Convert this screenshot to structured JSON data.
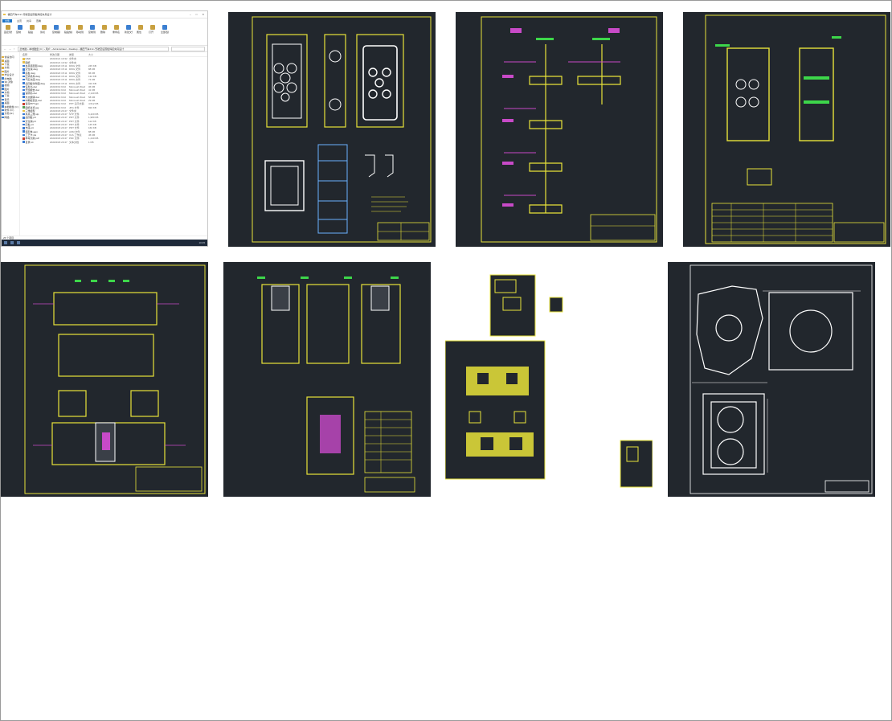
{
  "explorer": {
    "title": "福田汽车4×2~驾驶室后围板焊接夹具设计",
    "menu": [
      "文件",
      "主页",
      "共享",
      "查看"
    ],
    "active_menu": "文件",
    "ribbon": [
      "固定到快速访问",
      "复制",
      "粘贴",
      "剪切",
      "复制路径",
      "粘贴快捷方式",
      "移动到",
      "复制到",
      "删除",
      "重命名",
      "新建文件夹",
      "属性",
      "打开",
      "全部选择"
    ],
    "address": "此电脑 › 本地磁盘 (C:) › 用户 › Administrator › Desktop › 福田汽车4×2~驾驶室后围板焊接夹具设计",
    "nav": [
      "快速访问",
      "桌面",
      "下载",
      "文档",
      "图片",
      "毕业设计",
      "此电脑",
      "3D 对象",
      "视频",
      "图片",
      "文档",
      "下载",
      "音乐",
      "桌面",
      "本地磁盘 (C:)",
      "软件 (D:)",
      "文档 (E:)",
      "网络"
    ],
    "columns": [
      "名称",
      "修改日期",
      "类型",
      "大小"
    ],
    "files": [
      {
        "name": "CAD",
        "date": "2020/4/21 10:32",
        "type": "文件夹",
        "size": "",
        "kind": "folder"
      },
      {
        "name": "图纸",
        "date": "2020/4/21 10:32",
        "type": "文件夹",
        "size": "",
        "kind": "folder"
      },
      {
        "name": "夹具装配图.dwg",
        "date": "2020/4/20 15:11",
        "type": "DWG 文件",
        "size": "245 KB",
        "kind": "file"
      },
      {
        "name": "定位块.dwg",
        "date": "2020/4/20 15:11",
        "type": "DWG 文件",
        "size": "88 KB",
        "kind": "file"
      },
      {
        "name": "底板.dwg",
        "date": "2020/4/20 15:11",
        "type": "DWG 文件",
        "size": "96 KB",
        "kind": "file"
      },
      {
        "name": "压紧机构.dwg",
        "date": "2020/4/20 15:11",
        "type": "DWG 文件",
        "size": "132 KB",
        "kind": "file"
      },
      {
        "name": "气缸支座.dwg",
        "date": "2020/4/20 15:11",
        "type": "DWG 文件",
        "size": "74 KB",
        "kind": "file"
      },
      {
        "name": "后围板零件图.dwg",
        "date": "2020/4/20 15:11",
        "type": "DWG 文件",
        "size": "310 KB",
        "kind": "file"
      },
      {
        "name": "任务书.doc",
        "date": "2020/4/19 9:02",
        "type": "Microsoft Word",
        "size": "36 KB",
        "kind": "file"
      },
      {
        "name": "开题报告.doc",
        "date": "2020/4/19 9:02",
        "type": "Microsoft Word",
        "size": "41 KB",
        "kind": "file"
      },
      {
        "name": "说明书.doc",
        "date": "2020/4/19 9:02",
        "type": "Microsoft Word",
        "size": "2,140 KB",
        "kind": "file"
      },
      {
        "name": "外文翻译.doc",
        "date": "2020/4/19 9:02",
        "type": "Microsoft Word",
        "size": "58 KB",
        "kind": "file"
      },
      {
        "name": "中期检查表.doc",
        "date": "2020/4/19 9:02",
        "type": "Microsoft Word",
        "size": "29 KB",
        "kind": "file"
      },
      {
        "name": "答辩PPT.ppt",
        "date": "2020/4/19 9:02",
        "type": "PPT 演示文稿",
        "size": "4,512 KB",
        "kind": "pdf"
      },
      {
        "name": "图纸总览.jpg",
        "date": "2020/4/19 9:02",
        "type": "JPG 文件",
        "size": "820 KB",
        "kind": "img"
      },
      {
        "name": "三维模型",
        "date": "2020/4/18 20:47",
        "type": "文件夹",
        "size": "",
        "kind": "folder"
      },
      {
        "name": "夹具三维.stp",
        "date": "2020/4/18 20:47",
        "type": "STP 文件",
        "size": "6,420 KB",
        "kind": "file"
      },
      {
        "name": "后围板.prt",
        "date": "2020/4/18 20:47",
        "type": "PRT 文件",
        "size": "1,980 KB",
        "kind": "file"
      },
      {
        "name": "定位销.prt",
        "date": "2020/4/18 20:47",
        "type": "PRT 文件",
        "size": "112 KB",
        "kind": "file"
      },
      {
        "name": "压板.prt",
        "date": "2020/4/18 20:47",
        "type": "PRT 文件",
        "size": "145 KB",
        "kind": "file"
      },
      {
        "name": "支座.prt",
        "date": "2020/4/18 20:47",
        "type": "PRT 文件",
        "size": "160 KB",
        "kind": "file"
      },
      {
        "name": "装配体.asm",
        "date": "2020/4/18 20:47",
        "type": "ASM 文件",
        "size": "88 KB",
        "kind": "file"
      },
      {
        "name": "工艺卡.xls",
        "date": "2020/4/18 20:47",
        "type": "XLS 工作表",
        "size": "45 KB",
        "kind": "file"
      },
      {
        "name": "参考文献.pdf",
        "date": "2020/4/18 20:47",
        "type": "PDF 文件",
        "size": "1,240 KB",
        "kind": "pdf"
      },
      {
        "name": "目录.txt",
        "date": "2020/4/18 20:47",
        "type": "文本文档",
        "size": "1 KB",
        "kind": "file"
      }
    ],
    "status": "25 个项目",
    "clock": "10:45"
  },
  "drawings": [
    {
      "id": 1,
      "kind": "plate",
      "color": "#e8e33a"
    },
    {
      "id": 2,
      "kind": "grid-sections",
      "color": "#e8e33a"
    },
    {
      "id": 3,
      "kind": "assembly-table",
      "color": "#e8e33a"
    },
    {
      "id": 4,
      "kind": "fixture-plan",
      "color": "#e8e33a"
    },
    {
      "id": 5,
      "kind": "three-views",
      "color": "#e8e33a"
    },
    {
      "id": 6,
      "kind": "multi-sheet",
      "color": "#e8e33a"
    },
    {
      "id": 7,
      "kind": "casting",
      "color": "#ffffff"
    }
  ]
}
